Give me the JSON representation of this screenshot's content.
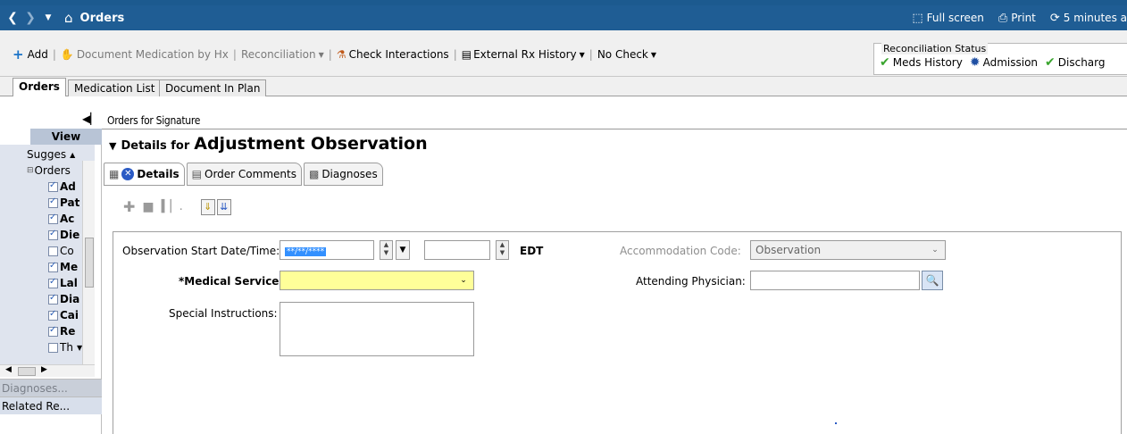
{
  "nav": {
    "title": "Orders",
    "home_icon": "home-icon",
    "full_screen": "Full screen",
    "print": "Print",
    "refresh": "5 minutes a"
  },
  "toolbar": {
    "add": "Add",
    "document_med": "Document Medication by Hx",
    "reconciliation": "Reconciliation",
    "check_interactions": "Check Interactions",
    "external_rx": "External Rx History",
    "no_check": "No Check"
  },
  "reconciliation_status": {
    "title": "Reconciliation Status",
    "meds_history": "Meds History",
    "admission": "Admission",
    "discharge": "Discharg"
  },
  "tabs": [
    "Orders",
    "Medication List",
    "Document In Plan"
  ],
  "left_panel": {
    "view_header": "View",
    "tree": [
      {
        "label": "Sugges",
        "checkbox": null,
        "bold": false
      },
      {
        "label": "Orders",
        "checkbox": null,
        "bold": false
      },
      {
        "label": "Ad",
        "checkbox": true,
        "bold": true
      },
      {
        "label": "Pat",
        "checkbox": true,
        "bold": true
      },
      {
        "label": "Ac",
        "checkbox": true,
        "bold": true
      },
      {
        "label": "Die",
        "checkbox": true,
        "bold": true
      },
      {
        "label": "Co",
        "checkbox": false,
        "bold": false
      },
      {
        "label": "Me",
        "checkbox": true,
        "bold": true
      },
      {
        "label": "Lal",
        "checkbox": true,
        "bold": true
      },
      {
        "label": "Dia",
        "checkbox": true,
        "bold": true
      },
      {
        "label": "Cai",
        "checkbox": true,
        "bold": true
      },
      {
        "label": "Re",
        "checkbox": true,
        "bold": true
      },
      {
        "label": "Th",
        "checkbox": false,
        "bold": false
      }
    ],
    "diagnoses": "Diagnoses...",
    "related": "Related Re..."
  },
  "content": {
    "orders_for_signature": "Orders for Signature",
    "details_for": "Details for",
    "order_name": "Adjustment Observation",
    "subtabs": [
      "Details",
      "Order Comments",
      "Diagnoses"
    ]
  },
  "form": {
    "obs_start_label": "Observation Start Date/Time:",
    "obs_date_value": "**/**/****",
    "timezone": "EDT",
    "accommodation_label": "Accommodation Code:",
    "accommodation_value": "Observation",
    "medical_service_label": "*Medical Service:",
    "medical_service_value": "",
    "attending_label": "Attending Physician:",
    "attending_value": "",
    "special_instructions_label": "Special Instructions:",
    "special_instructions_value": ""
  }
}
